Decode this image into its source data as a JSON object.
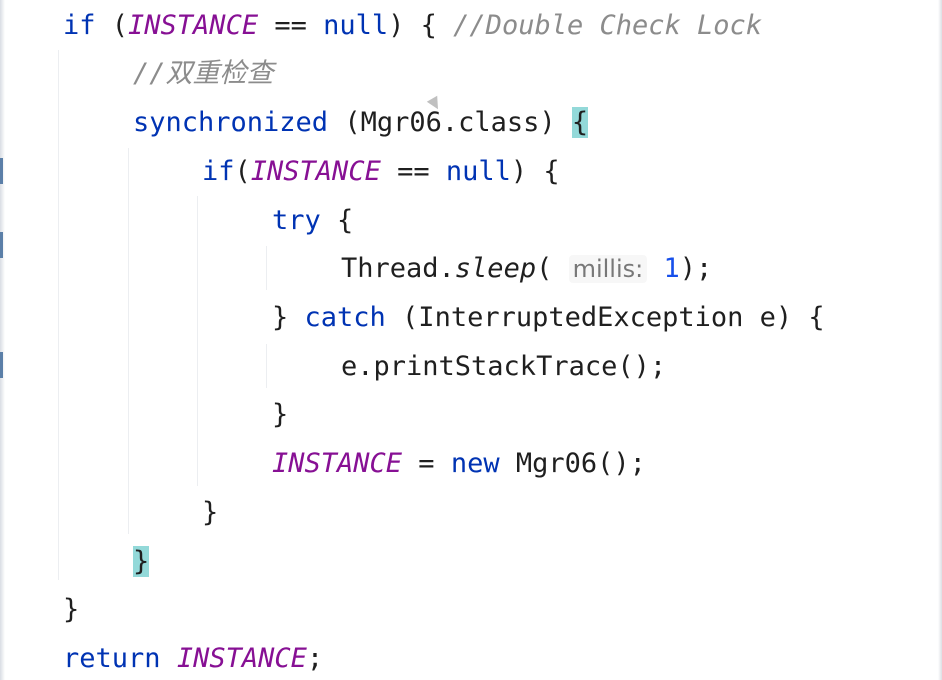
{
  "code": {
    "line1": {
      "kw_if": "if",
      "open": " (",
      "field": "INSTANCE",
      "op": " == ",
      "kw_null": "null",
      "close": ") { ",
      "comment": "//Double Check Lock"
    },
    "line2": {
      "comment": "//双重检查"
    },
    "line3": {
      "kw": "synchronized",
      "expr": " (Mgr06.class) ",
      "brace": "{"
    },
    "line4": {
      "kw_if": "if",
      "open": "(",
      "field": "INSTANCE",
      "op": " == ",
      "kw_null": "null",
      "close": ") {"
    },
    "line5": {
      "kw": "try",
      "rest": " {"
    },
    "line6": {
      "cls": "Thread.",
      "method": "sleep",
      "open": "( ",
      "hint": "millis:",
      "num": "1",
      "close": ");"
    },
    "line7": {
      "open": "} ",
      "kw": "catch",
      "rest": " (InterruptedException e) {"
    },
    "line8": {
      "text": "e.printStackTrace();"
    },
    "line9": {
      "text": "}"
    },
    "line10": {
      "field": "INSTANCE",
      "assign": " = ",
      "kw": "new",
      "rest": " Mgr06();"
    },
    "line11": {
      "text": "}"
    },
    "line12": {
      "brace": "}"
    },
    "line13": {
      "text": "}"
    },
    "line14": {
      "kw": "return",
      "sp": " ",
      "field": "INSTANCE",
      "end": ";"
    }
  },
  "colors": {
    "keyword": "#0033b3",
    "field": "#871094",
    "comment": "#8c8c8c",
    "number": "#1750eb",
    "brace_highlight": "#93d9d9"
  }
}
